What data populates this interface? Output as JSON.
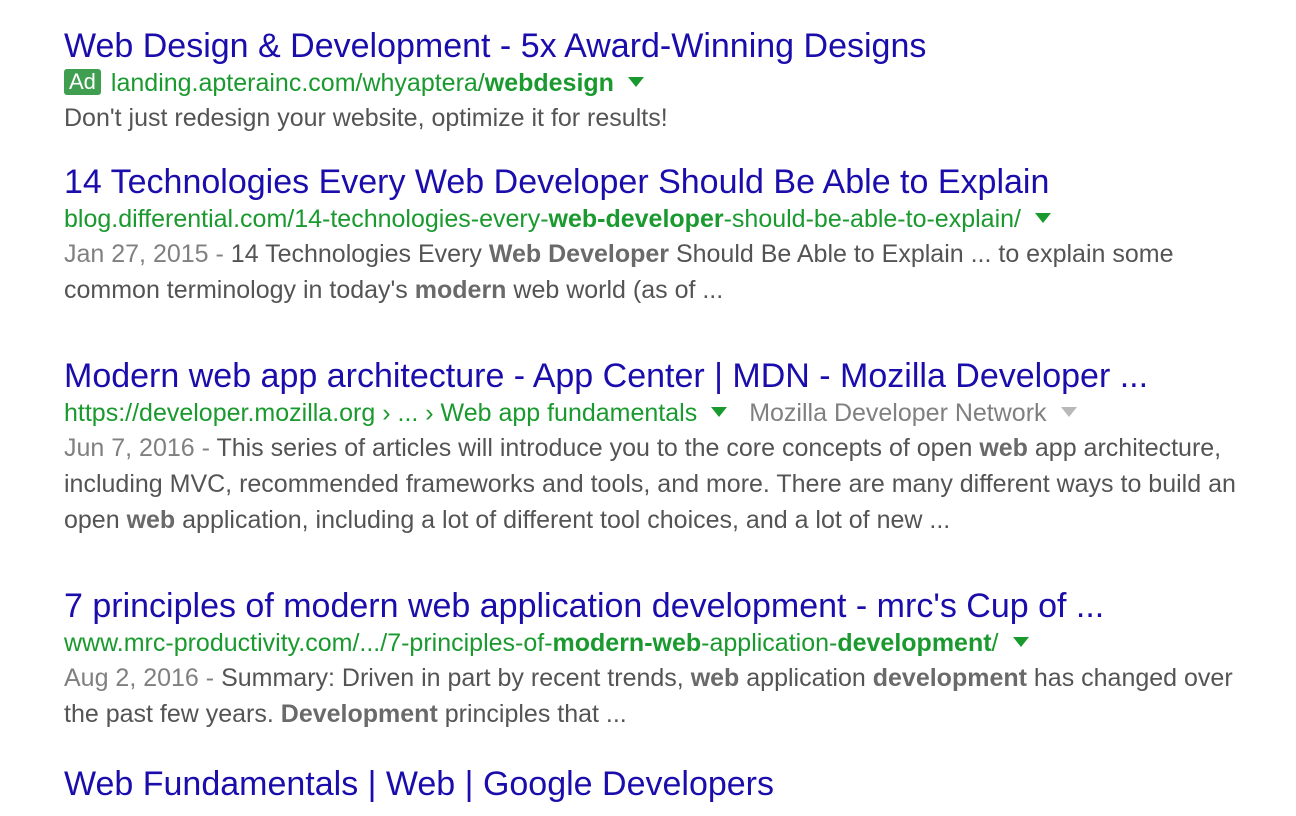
{
  "results": [
    {
      "title": "Web Design & Development - 5x Award-Winning Designs",
      "ad_label": "Ad",
      "url_pre": "landing.apterainc.com/whyaptera/",
      "url_bold": "webdesign",
      "snippet": "Don't just redesign your website, optimize it for results!"
    },
    {
      "title": "14 Technologies Every Web Developer Should Be Able to Explain",
      "url_p1": "blog.differential.com/14-technologies-every-",
      "url_b1": "web-developer",
      "url_p2": "-should-be-able-to-explain/",
      "date": "Jan 27, 2015",
      "date_sep": " - ",
      "s1": "14 Technologies Every ",
      "b1": "Web Developer",
      "s2": " Should Be Able to Explain ... to explain some common terminology in today's ",
      "b2": "modern",
      "s3": " web world (as of ..."
    },
    {
      "title": "Modern web app architecture - App Center | MDN - Mozilla Developer ...",
      "url": "https://developer.mozilla.org › ... › Web app fundamentals",
      "site_name": "Mozilla Developer Network",
      "date": "Jun 7, 2016",
      "date_sep": " - ",
      "s1": "This series of articles will introduce you to the core concepts of open ",
      "b1": "web",
      "s2": " app architecture, including MVC, recommended frameworks and tools, and more. There are many different ways to build an open ",
      "b2": "web",
      "s3": " application, including a lot of different tool choices, and a lot of new ..."
    },
    {
      "title": "7 principles of modern web application development - mrc's Cup of ...",
      "url_p1": "www.mrc-productivity.com/.../7-principles-of-",
      "url_b1": "modern-web",
      "url_p2": "-application-",
      "url_b2": "development",
      "url_p3": "/",
      "date": "Aug 2, 2016",
      "date_sep": " - ",
      "s1": "Summary: Driven in part by recent trends, ",
      "b1": "web",
      "s2": " application ",
      "b2": "development",
      "s3": " has changed over the past few years. ",
      "b3": "Development",
      "s4": " principles that ..."
    },
    {
      "title": "Web Fundamentals | Web | Google Developers"
    }
  ]
}
